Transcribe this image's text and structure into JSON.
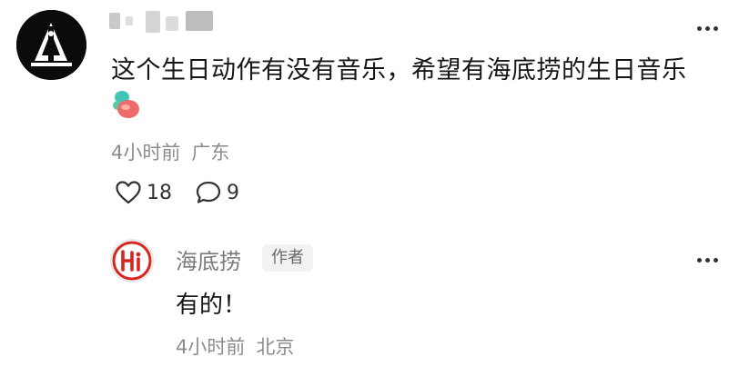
{
  "comment": {
    "text": "这个生日动作有没有音乐，希望有海底捞的生日音乐",
    "time": "4小时前",
    "region": "广东",
    "likes": "18",
    "replies_count": "9"
  },
  "reply": {
    "username": "海底捞",
    "badge": "作者",
    "text": "有的！",
    "time": "4小时前",
    "region": "北京"
  },
  "colors": {
    "brand_red": "#d7261e",
    "meta_gray": "#8c8c8c",
    "badge_bg": "#f2f2f2"
  },
  "icons": {
    "like": "heart-outline-icon",
    "reply": "speech-bubble-icon",
    "more": "ellipsis-icon"
  }
}
